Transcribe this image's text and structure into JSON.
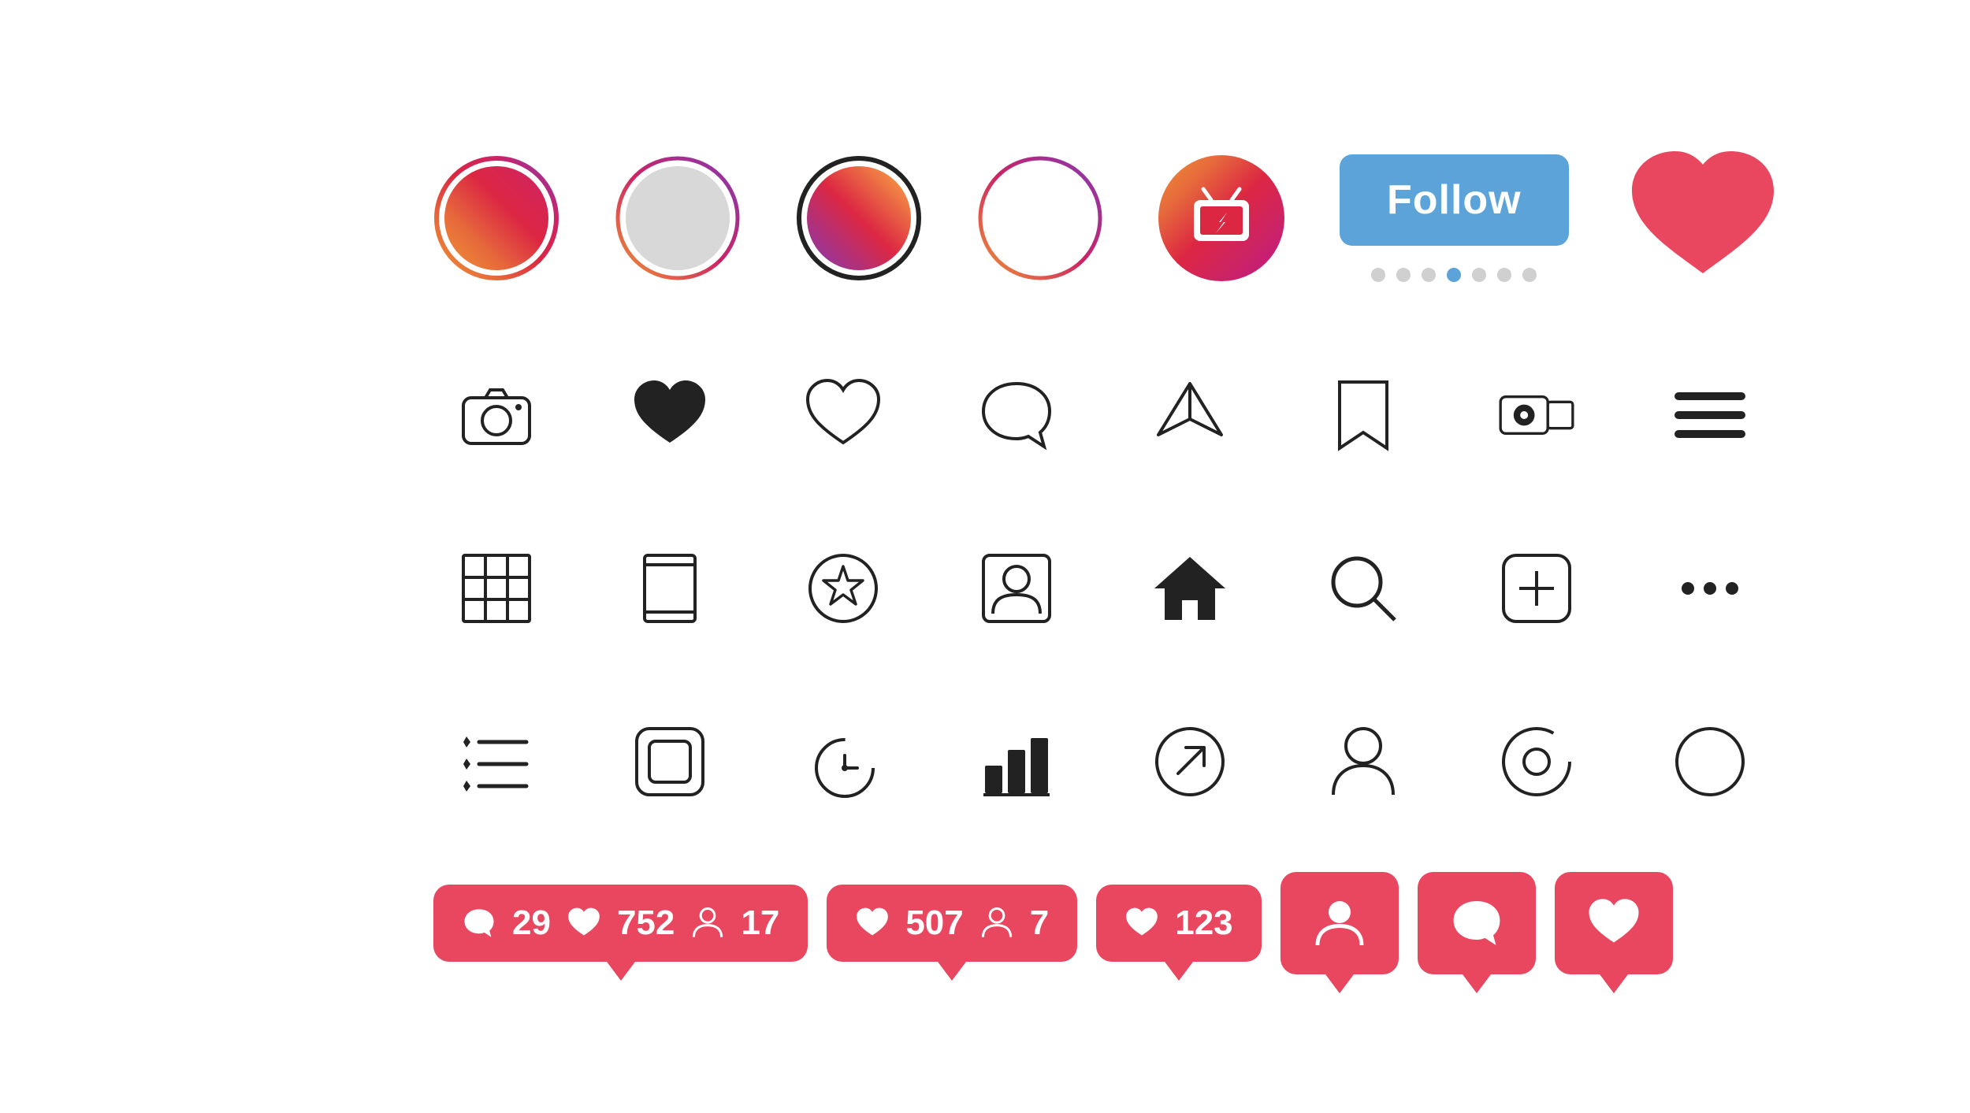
{
  "ui": {
    "follow_button": "Follow",
    "dots": [
      {
        "active": false
      },
      {
        "active": false
      },
      {
        "active": false
      },
      {
        "active": true
      },
      {
        "active": false
      },
      {
        "active": false
      },
      {
        "active": false
      }
    ],
    "notifications": [
      {
        "icon_comment": "💬",
        "count_comment": "29",
        "icon_heart": "♥",
        "count_heart": "752",
        "icon_person": "👤",
        "count_person": "17"
      },
      {
        "icon_heart": "♥",
        "count_heart": "507",
        "icon_person": "👤",
        "count_person": "7"
      },
      {
        "icon_heart": "♥",
        "count_heart": "123"
      }
    ]
  }
}
